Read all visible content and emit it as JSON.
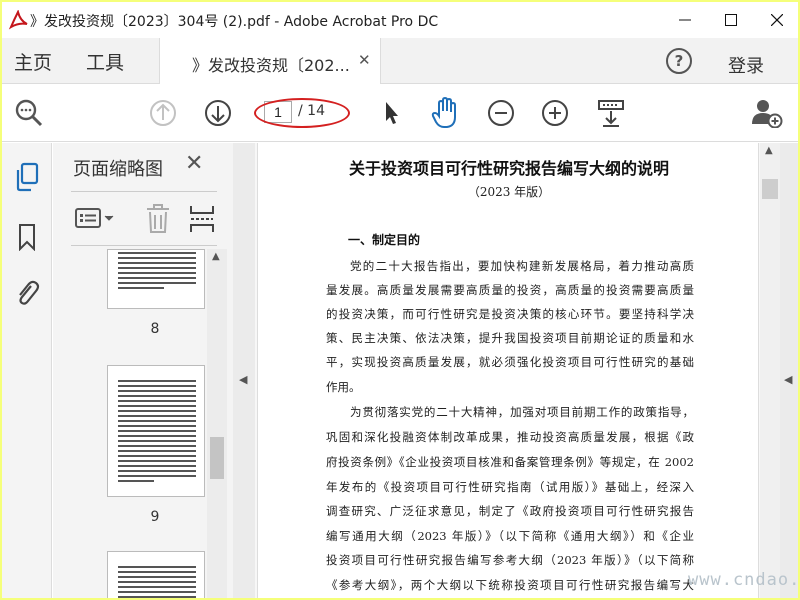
{
  "window": {
    "title": "》发改投资规〔2023〕304号 (2).pdf - Adobe Acrobat Pro DC"
  },
  "menu": {
    "home": "主页",
    "tools": "工具",
    "doc_tab": "》发改投资规〔202...",
    "help": "?",
    "login": "登录"
  },
  "toolbar": {
    "current_page": "1",
    "total_pages": "/ 14"
  },
  "thumbnails_panel": {
    "title": "页面缩略图",
    "pages": [
      "8",
      "9"
    ]
  },
  "document": {
    "title": "关于投资项目可行性研究报告编写大纲的说明",
    "subtitle": "（2023 年版）",
    "heading": "一、制定目的",
    "para1": [
      "党的二十大报告指出，要加快构建新发展格局，着力推动高质",
      "量发展。高质量发展需要高质量的投资，高质量的投资需要高质量",
      "的投资决策，而可行性研究是投资决策的核心环节。要坚持科学决",
      "策、民主决策、依法决策，提升我国投资项目前期论证的质量和水",
      "平，实现投资高质量发展，就必须强化投资项目可行性研究的基础",
      "作用。"
    ],
    "para2": [
      "为贯彻落实党的二十大精神，加强对项目前期工作的政策指导，",
      "巩固和深化投融资体制改革成果，推动投资高质量发展，根据《政",
      "府投资条例》《企业投资项目核准和备案管理条例》等规定，在 2002",
      "年发布的《投资项目可行性研究指南（试用版）》基础上，经深入",
      "调查研究、广泛征求意见，制定了《政府投资项目可行性研究报告",
      "编写通用大纲（2023 年版）》（以下简称《通用大纲》）和《企业",
      "投资项目可行性研究报告编写参考大纲（2023 年版）》（以下简称",
      "《参考大纲》，两个大纲以下统称投资项目可行性研究报告编写大"
    ]
  },
  "watermark": "www.cndao.com",
  "colors": {
    "border": "#f5ff7a",
    "annotation": "#d42020",
    "active_blue": "#1f6fb8"
  }
}
